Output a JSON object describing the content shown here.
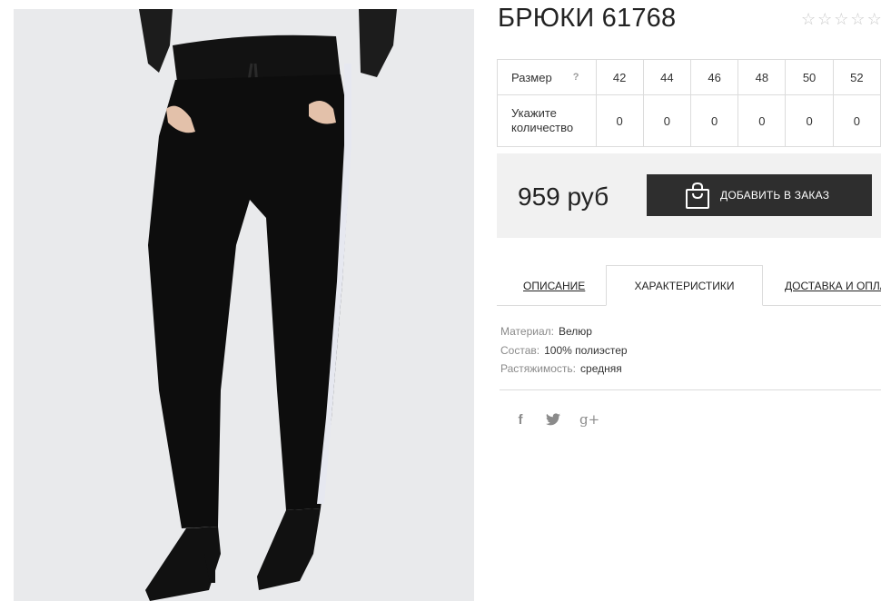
{
  "product": {
    "title": "БРЮКИ 61768",
    "rating_stars": 5,
    "rating_value": 0
  },
  "sizes": {
    "size_label": "Размер",
    "help_icon": "?",
    "qty_label": "Укажите количество",
    "values": [
      "42",
      "44",
      "46",
      "48",
      "50",
      "52"
    ],
    "quantities": [
      "0",
      "0",
      "0",
      "0",
      "0",
      "0"
    ]
  },
  "purchase": {
    "price": "959 руб",
    "add_button": "ДОБАВИТЬ В ЗАКАЗ",
    "button_icon": "shopping-bag-icon"
  },
  "tabs": {
    "description": "ОПИСАНИЕ",
    "characteristics": "ХАРАКТЕРИСТИКИ",
    "delivery": "ДОСТАВКА И ОПЛАТА",
    "active": "characteristics"
  },
  "specs": [
    {
      "key": "Материал:",
      "value": "Велюр"
    },
    {
      "key": "Состав:",
      "value": "100% полиэстер"
    },
    {
      "key": "Растяжимость:",
      "value": "средняя"
    }
  ],
  "social": [
    {
      "name": "facebook-icon",
      "glyph": "f"
    },
    {
      "name": "twitter-icon",
      "glyph": ""
    },
    {
      "name": "google-plus-icon",
      "glyph": "g+"
    }
  ],
  "colors": {
    "button_bg": "#2e2e2e",
    "price_box_bg": "#f1f1f1",
    "photo_bg": "#e9eaec",
    "star_empty": "#c9c9c9"
  }
}
